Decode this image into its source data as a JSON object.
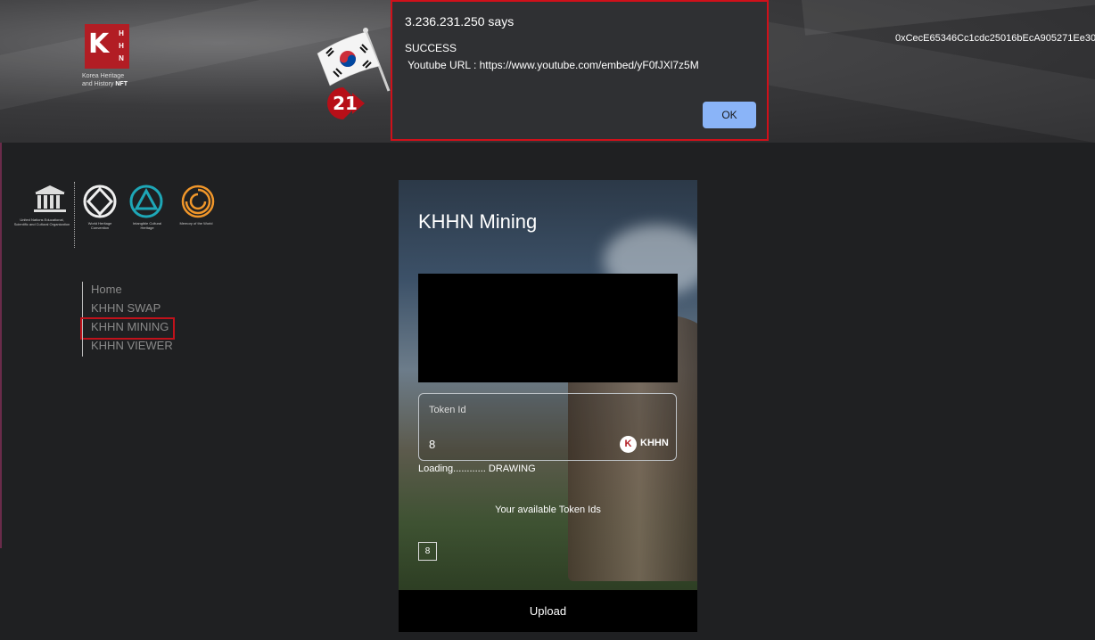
{
  "header": {
    "brand": {
      "logo_letter": "K",
      "logo_side": [
        "H",
        "H",
        "N"
      ],
      "caption_line1": "Korea Heritage",
      "caption_line2": "and History",
      "caption_bold": "NFT"
    },
    "step_badge": "21",
    "wallet_address": "0xCecE65346Cc1cdc25016bEcA905271Ee30"
  },
  "dialog": {
    "title": "3.236.231.250 says",
    "message_line1": "SUCCESS",
    "message_line2": " Youtube URL : https://www.youtube.com/embed/yF0fJXl7z5M",
    "ok_label": "OK",
    "ok_color": "#8ab4f8",
    "border_color": "#d0101a"
  },
  "logos": [
    {
      "icon": "unesco-temple-icon",
      "caption": "United Nations Educational, Scientific and Cultural Organization"
    },
    {
      "icon": "world-heritage-icon",
      "caption": "World Heritage Convention"
    },
    {
      "icon": "intangible-heritage-icon",
      "caption": "Intangible Cultural Heritage"
    },
    {
      "icon": "memory-of-world-icon",
      "caption": "Memory of the World"
    }
  ],
  "nav": {
    "items": [
      {
        "label": "Home"
      },
      {
        "label": "KHHN SWAP"
      },
      {
        "label": "KHHN MINING"
      },
      {
        "label": "KHHN VIEWER"
      }
    ],
    "selected": "KHHN MINING",
    "highlight_color": "#c0121b"
  },
  "card": {
    "title": "KHHN Mining",
    "token_field": {
      "label": "Token Id",
      "value": "8",
      "badge_letter": "K",
      "badge_text": "KHHN"
    },
    "loading_text": "Loading............ DRAWING",
    "available_title": "Your available Token Ids",
    "available_ids": [
      "8"
    ],
    "upload_label": "Upload"
  }
}
